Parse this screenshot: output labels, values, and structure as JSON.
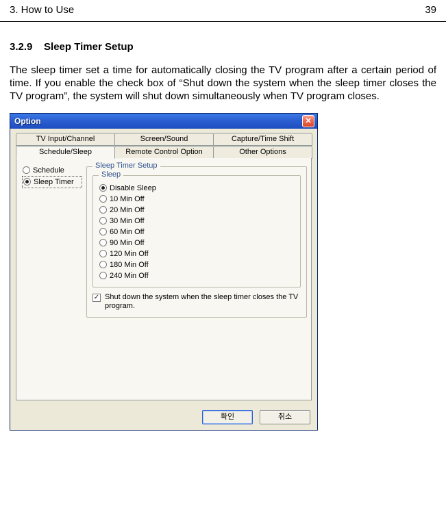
{
  "header": {
    "chapter": "3.   How to Use",
    "page_number": "39"
  },
  "section": {
    "number": "3.2.9",
    "title": "Sleep Timer Setup"
  },
  "body": "The sleep timer set a time for automatically closing the TV program after a certain period of time. If you enable the check box of “Shut down the system when the sleep timer closes the TV program”, the system will shut down simultaneously when TV program closes.",
  "dialog": {
    "title": "Option",
    "tabs_back": [
      "TV Input/Channel",
      "Screen/Sound",
      "Capture/Time Shift"
    ],
    "tabs_front": [
      "Schedule/Sleep",
      "Remote Control Option",
      "Other Options"
    ],
    "active_tab": "Schedule/Sleep",
    "modes": {
      "schedule": "Schedule",
      "sleep_timer": "Sleep Timer",
      "selected": "sleep_timer"
    },
    "group_outer_legend": "Sleep Timer Setup",
    "group_inner_legend": "Sleep",
    "sleep_options": [
      "Disable Sleep",
      "10 Min Off",
      "20 Min Off",
      "30 Min Off",
      "60 Min Off",
      "90 Min Off",
      "120 Min Off",
      "180 Min Off",
      "240 Min Off"
    ],
    "sleep_selected_index": 0,
    "shutdown_checked": true,
    "shutdown_label": "Shut down the system when the sleep timer closes the TV program.",
    "buttons": {
      "ok": "확인",
      "cancel": "취소"
    }
  }
}
